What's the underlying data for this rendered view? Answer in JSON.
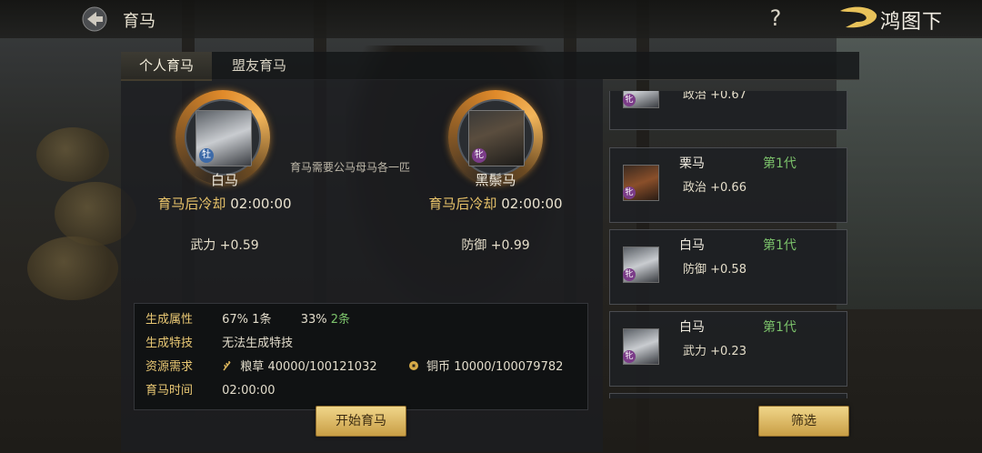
{
  "header": {
    "title": "育马",
    "help_glyph": "?",
    "logo_text": "鸿图下"
  },
  "tabs": [
    {
      "label": "个人育马"
    },
    {
      "label": "盟友育马"
    }
  ],
  "breeding": {
    "hint": "育马需要公马母马各一匹",
    "male": {
      "gender": "牡",
      "name": "白马",
      "cooldown_label": "育马后冷却",
      "cooldown_time": "02:00:00",
      "stat": "武力 +0.59"
    },
    "female": {
      "gender": "牝",
      "name": "黑鬃马",
      "cooldown_label": "育马后冷却",
      "cooldown_time": "02:00:00",
      "stat": "防御 +0.99"
    }
  },
  "info": {
    "gen_attr_label": "生成属性",
    "gen_attr_a": "67% 1条",
    "gen_attr_b_pct": "33%",
    "gen_attr_b_count": "2条",
    "gen_skill_label": "生成特技",
    "gen_skill_value": "无法生成特技",
    "resource_label": "资源需求",
    "grain_label": "粮草",
    "grain_value": "40000/100121032",
    "copper_label": "铜币",
    "copper_value": "10000/100079782",
    "time_label": "育马时间",
    "time_value": "02:00:00"
  },
  "buttons": {
    "start": "开始育马",
    "filter": "筛选"
  },
  "horse_list": [
    {
      "name": "",
      "generation": "",
      "stat": "政治 +0.67",
      "gender": "牝",
      "coat": "white"
    },
    {
      "name": "栗马",
      "generation": "第1代",
      "stat": "政治 +0.66",
      "gender": "牝",
      "coat": "chestnut"
    },
    {
      "name": "白马",
      "generation": "第1代",
      "stat": "防御 +0.58",
      "gender": "牝",
      "coat": "white"
    },
    {
      "name": "白马",
      "generation": "第1代",
      "stat": "武力 +0.23",
      "gender": "牝",
      "coat": "white"
    }
  ],
  "colors": {
    "accent": "#c9a85e",
    "highlight_green": "#7cc36b",
    "label_gold": "#e9c874",
    "button_gold": "#f0d68a"
  }
}
